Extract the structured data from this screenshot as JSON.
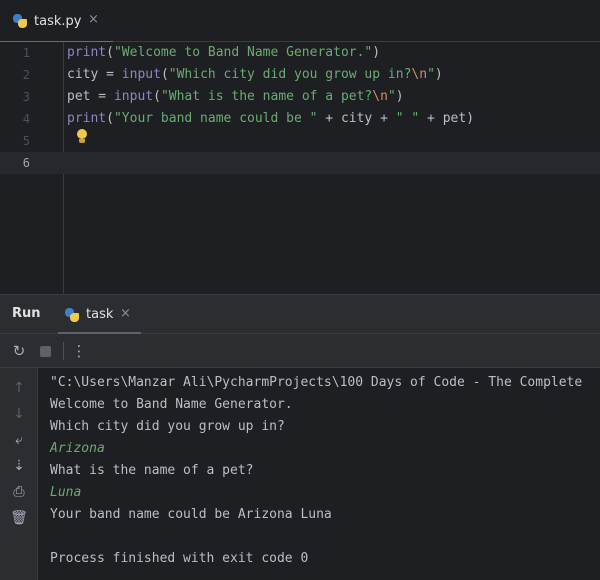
{
  "editor_tab": {
    "filename": "task.py",
    "close": "×"
  },
  "editor": {
    "line_numbers": [
      "1",
      "2",
      "3",
      "4",
      "5",
      "6"
    ],
    "lines": [
      {
        "parts": [
          {
            "t": "print",
            "c": "fn"
          },
          {
            "t": "(",
            "c": ""
          },
          {
            "t": "\"Welcome to Band Name Generator.\"",
            "c": "str"
          },
          {
            "t": ")",
            "c": ""
          }
        ]
      },
      {
        "parts": [
          {
            "t": "city = ",
            "c": ""
          },
          {
            "t": "input",
            "c": "fn"
          },
          {
            "t": "(",
            "c": ""
          },
          {
            "t": "\"Which city did you grow up in?",
            "c": "str"
          },
          {
            "t": "\\n",
            "c": "esc"
          },
          {
            "t": "\"",
            "c": "str"
          },
          {
            "t": ")",
            "c": ""
          }
        ]
      },
      {
        "parts": [
          {
            "t": "pet = ",
            "c": ""
          },
          {
            "t": "input",
            "c": "fn"
          },
          {
            "t": "(",
            "c": ""
          },
          {
            "t": "\"What is the name of a pet?",
            "c": "str"
          },
          {
            "t": "\\n",
            "c": "esc"
          },
          {
            "t": "\"",
            "c": "str"
          },
          {
            "t": ")",
            "c": ""
          }
        ]
      },
      {
        "parts": [
          {
            "t": "print",
            "c": "fn"
          },
          {
            "t": "(",
            "c": ""
          },
          {
            "t": "\"Your band name could be \"",
            "c": "str"
          },
          {
            "t": " + city + ",
            "c": ""
          },
          {
            "t": "\" \"",
            "c": "str"
          },
          {
            "t": " + pet)",
            "c": ""
          }
        ]
      },
      {
        "parts": []
      },
      {
        "parts": []
      }
    ],
    "current_line": 6
  },
  "run_panel": {
    "title": "Run",
    "tab_label": "task",
    "tab_close": "×"
  },
  "console": {
    "lines": [
      {
        "text": "\"C:\\Users\\Manzar Ali\\PycharmProjects\\100 Days of Code - The Complete",
        "kind": "out"
      },
      {
        "text": "Welcome to Band Name Generator.",
        "kind": "out"
      },
      {
        "text": "Which city did you grow up in?",
        "kind": "out"
      },
      {
        "text": "Arizona",
        "kind": "input"
      },
      {
        "text": "What is the name of a pet?",
        "kind": "out"
      },
      {
        "text": "Luna",
        "kind": "input"
      },
      {
        "text": "Your band name could be Arizona Luna",
        "kind": "out"
      },
      {
        "text": "",
        "kind": "out"
      },
      {
        "text": "Process finished with exit code 0",
        "kind": "out"
      }
    ]
  },
  "icons": {
    "rerun": "↻",
    "more": "⋮",
    "up": "↑",
    "down": "↓",
    "soft_wrap": "⤶",
    "scroll_end": "⇣",
    "print": "⎙",
    "trash": "🗑"
  }
}
